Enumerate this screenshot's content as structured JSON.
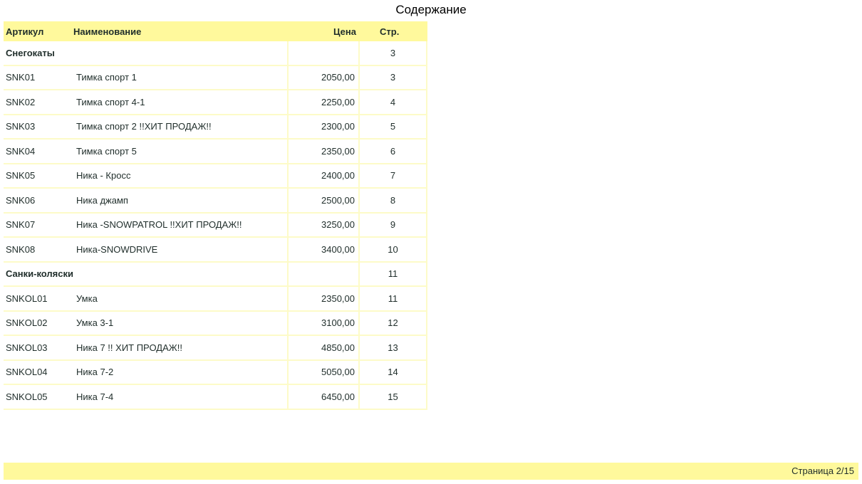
{
  "title": "Содержание",
  "columns": {
    "article": "Артикул",
    "name": "Наименование",
    "price": "Цена",
    "page": "Стр."
  },
  "rows": [
    {
      "type": "group",
      "label": "Снегокаты",
      "page": "3"
    },
    {
      "type": "item",
      "article": "SNK01",
      "name": "Тимка спорт 1",
      "price": "2050,00",
      "page": "3"
    },
    {
      "type": "item",
      "article": "SNK02",
      "name": "Тимка спорт 4-1",
      "price": "2250,00",
      "page": "4"
    },
    {
      "type": "item",
      "article": "SNK03",
      "name": "Тимка спорт 2 !!ХИТ ПРОДАЖ!!",
      "price": "2300,00",
      "page": "5"
    },
    {
      "type": "item",
      "article": "SNK04",
      "name": "Тимка спорт 5",
      "price": "2350,00",
      "page": "6"
    },
    {
      "type": "item",
      "article": "SNK05",
      "name": "Ника - Кросс",
      "price": "2400,00",
      "page": "7"
    },
    {
      "type": "item",
      "article": "SNK06",
      "name": "Ника джамп",
      "price": "2500,00",
      "page": "8"
    },
    {
      "type": "item",
      "article": "SNK07",
      "name": "Ника -SNOWPATROL !!ХИТ ПРОДАЖ!!",
      "price": "3250,00",
      "page": "9"
    },
    {
      "type": "item",
      "article": "SNK08",
      "name": "Ника-SNOWDRIVE",
      "price": "3400,00",
      "page": "10"
    },
    {
      "type": "group",
      "label": "Санки-коляски",
      "page": "11"
    },
    {
      "type": "item",
      "article": "SNKOL01",
      "name": "Умка",
      "price": "2350,00",
      "page": "11"
    },
    {
      "type": "item",
      "article": "SNKOL02",
      "name": "Умка 3-1",
      "price": "3100,00",
      "page": "12"
    },
    {
      "type": "item",
      "article": "SNKOL03",
      "name": "Ника 7 !! ХИТ ПРОДАЖ!!",
      "price": "4850,00",
      "page": "13"
    },
    {
      "type": "item",
      "article": "SNKOL04",
      "name": "Ника 7-2",
      "price": "5050,00",
      "page": "14"
    },
    {
      "type": "item",
      "article": "SNKOL05",
      "name": "Ника 7-4",
      "price": "6450,00",
      "page": "15"
    }
  ],
  "footer": {
    "page_label": "Страница 2/15"
  },
  "colors": {
    "header_bg": "#fff99c",
    "grid_line": "#fdfbc8",
    "text": "#1f2d2a"
  }
}
